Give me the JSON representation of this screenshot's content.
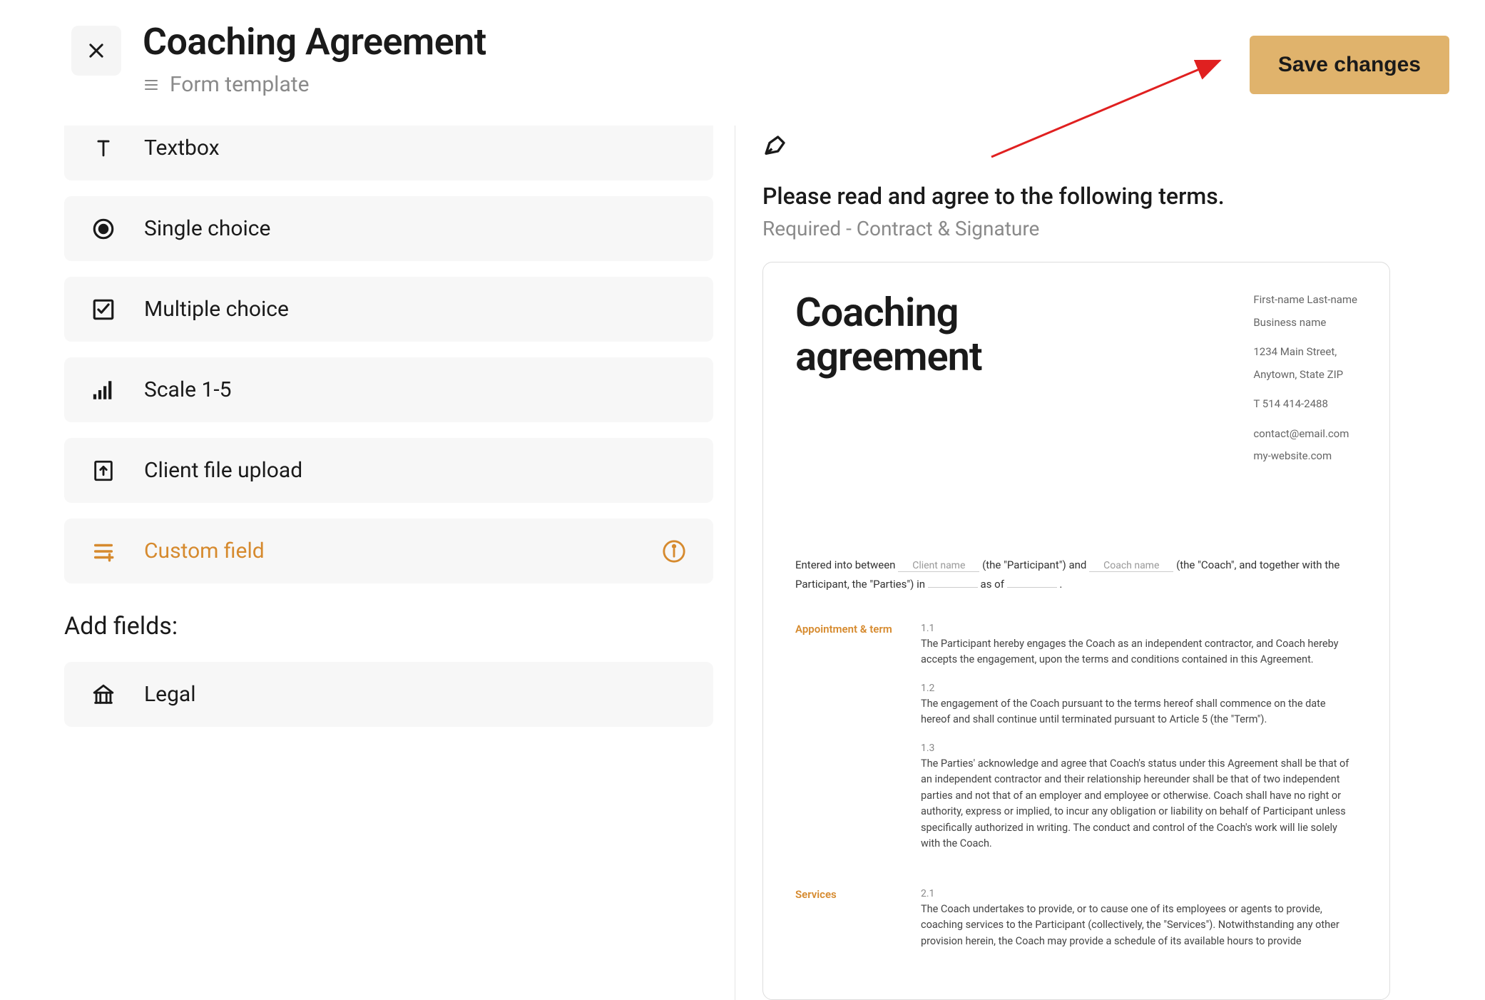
{
  "header": {
    "title": "Coaching Agreement",
    "subtitle": "Form template",
    "save_label": "Save changes"
  },
  "field_types": {
    "textbox": "Textbox",
    "single_choice": "Single choice",
    "multiple_choice": "Multiple choice",
    "scale": "Scale 1-5",
    "file_upload": "Client file upload",
    "custom": "Custom field"
  },
  "add_fields_heading": "Add fields:",
  "add_fields": {
    "legal": "Legal"
  },
  "preview": {
    "title": "Please read and agree to the following terms.",
    "subtitle": "Required - Contract & Signature"
  },
  "doc": {
    "title_line1": "Coaching",
    "title_line2": "agreement",
    "meta": {
      "name": "First-name Last-name",
      "business": "Business name",
      "address1": "1234 Main Street,",
      "address2": "Anytown, State ZIP",
      "phone": "T 514 414-2488",
      "email": "contact@email.com",
      "website": "my-website.com"
    },
    "intro": {
      "t1": "Entered into between",
      "ph1": "Client name",
      "t2": "(the \"Participant\") and",
      "ph2": "Coach name",
      "t3": "(the \"Coach\", and together with the Participant, the \"Parties\") in",
      "t4": "as of",
      "t5": "."
    },
    "sections": [
      {
        "label": "Appointment & term",
        "clauses": [
          {
            "num": "1.1",
            "text": "The Participant hereby engages the Coach as an independent contractor, and Coach hereby accepts the engagement, upon the terms and conditions contained in this Agreement."
          },
          {
            "num": "1.2",
            "text": "The engagement of the Coach pursuant to the terms hereof shall commence on the date hereof and shall continue until terminated pursuant to Article 5 (the \"Term\")."
          },
          {
            "num": "1.3",
            "text": "The Parties' acknowledge and agree that Coach's status under this Agreement shall be that of an independent contractor and their relationship hereunder shall be that of two independent parties and not that of an employer and employee or otherwise. Coach shall have no right or authority, express or implied, to incur any obligation or liability on behalf of Participant unless specifically authorized in writing. The conduct and control of the Coach's work will lie solely with the Coach."
          }
        ]
      },
      {
        "label": "Services",
        "clauses": [
          {
            "num": "2.1",
            "text": "The Coach undertakes to provide, or to cause one of its employees or agents to provide, coaching services to the Participant (collectively, the \"Services\"). Notwithstanding any other provision herein, the Coach may provide a schedule of its available hours to provide"
          }
        ]
      }
    ]
  }
}
